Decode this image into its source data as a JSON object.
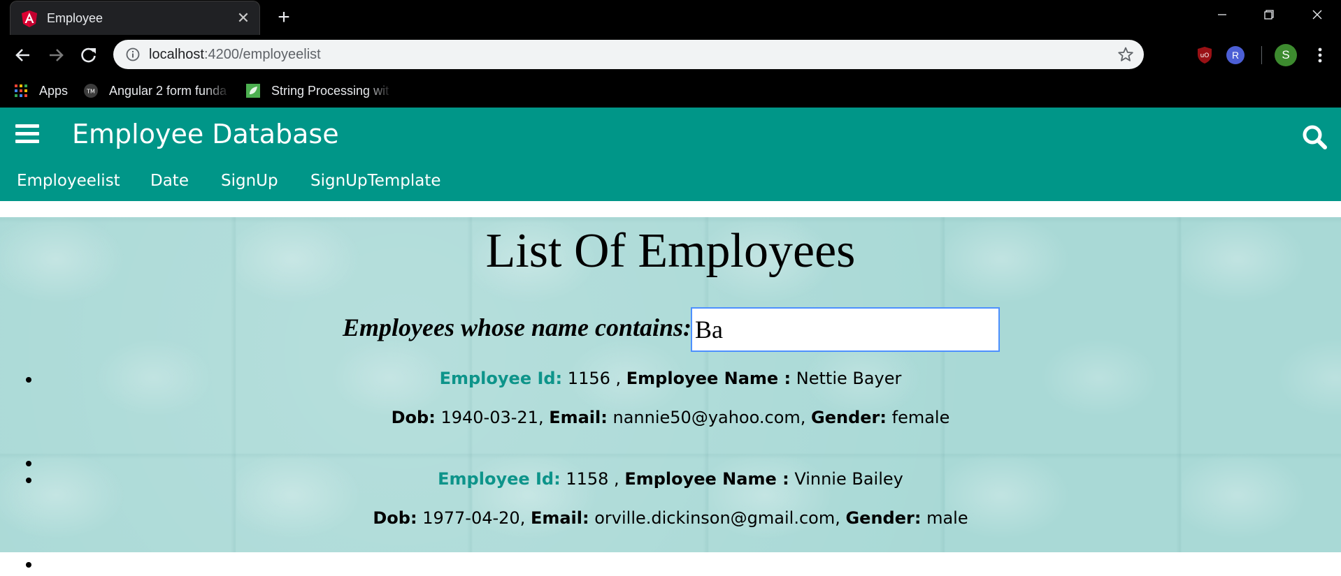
{
  "browser": {
    "tab_title": "Employee",
    "url_host": "localhost",
    "url_rest": ":4200/employeelist",
    "bookmarks": [
      {
        "label": "Apps",
        "icon": "apps-grid-icon"
      },
      {
        "label": "Angular 2 form funda",
        "icon": "tm-icon"
      },
      {
        "label": "String Processing wit",
        "icon": "leaf-icon"
      }
    ],
    "profile_initial": "S",
    "extension_r_label": "R"
  },
  "app": {
    "title": "Employee Database",
    "nav": [
      "Employeelist",
      "Date",
      "SignUp",
      "SignUpTemplate"
    ]
  },
  "page": {
    "heading": "List Of Employees",
    "filter_label": "Employees whose name contains:",
    "filter_value": "Ba"
  },
  "labels": {
    "id": "Employee Id:",
    "name": "Employee Name :",
    "dob": "Dob:",
    "email": "Email:",
    "gender": "Gender:"
  },
  "employees": [
    {
      "id": "1156",
      "name": "Nettie Bayer",
      "dob": "1940-03-21",
      "email": "nannie50@yahoo.com",
      "gender": "female"
    },
    {
      "id": "1158",
      "name": "Vinnie Bailey",
      "dob": "1977-04-20",
      "email": "orville.dickinson@gmail.com",
      "gender": "male"
    }
  ],
  "colors": {
    "header_bg": "#009688",
    "id_label": "#0d948a",
    "content_bg": "#a9d9d6"
  }
}
